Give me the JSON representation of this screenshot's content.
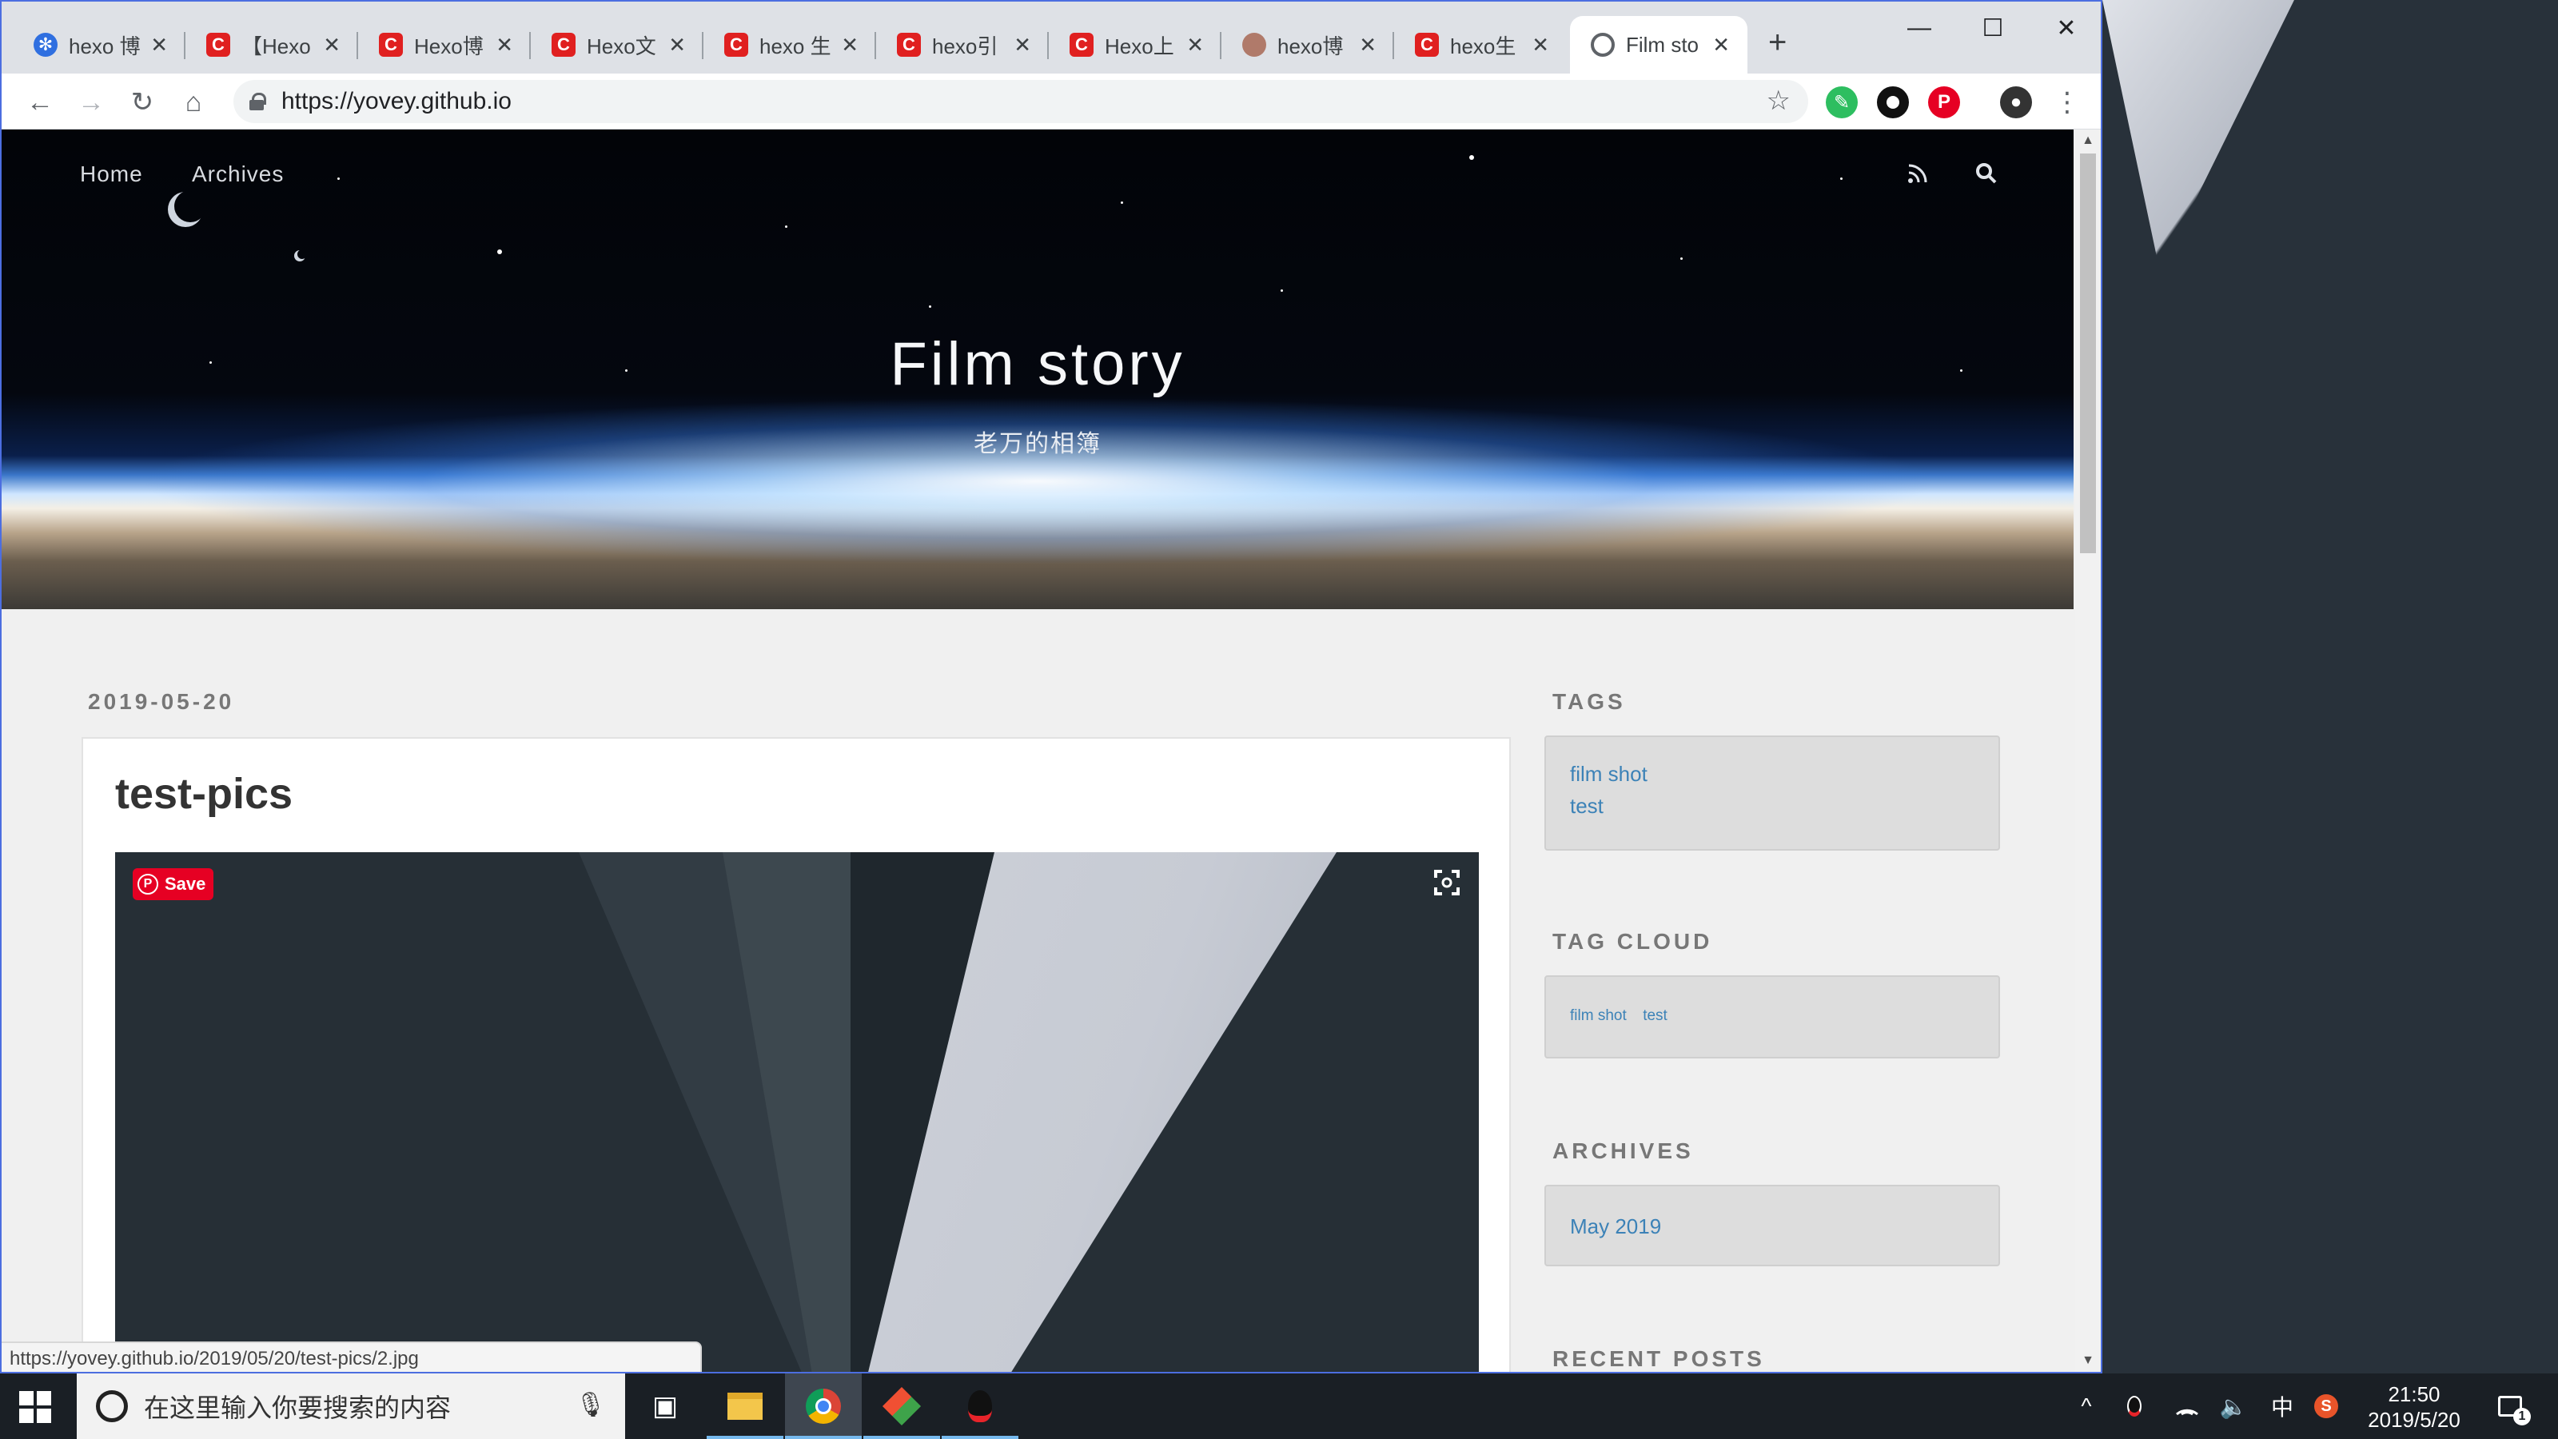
{
  "browser": {
    "tabs": [
      {
        "title": "hexo 博",
        "icon": "baidu-paw-icon"
      },
      {
        "title": "【Hexo",
        "icon": "csdn-icon"
      },
      {
        "title": "Hexo博",
        "icon": "csdn-icon"
      },
      {
        "title": "Hexo文",
        "icon": "csdn-icon"
      },
      {
        "title": "hexo 生",
        "icon": "csdn-icon"
      },
      {
        "title": "hexo引",
        "icon": "csdn-icon"
      },
      {
        "title": "Hexo上",
        "icon": "csdn-icon"
      },
      {
        "title": "hexo博",
        "icon": "anime-avatar-icon"
      },
      {
        "title": "hexo生",
        "icon": "csdn-icon"
      },
      {
        "title": "Film sto",
        "icon": "globe-icon",
        "active": true
      }
    ],
    "new_tab": "+",
    "url": "https://yovey.github.io",
    "status_url": "https://yovey.github.io/2019/05/20/test-pics/2.jpg"
  },
  "site": {
    "nav": {
      "home": "Home",
      "archives": "Archives"
    },
    "title": "Film story",
    "subtitle": "老万的相簿"
  },
  "post": {
    "date": "2019-05-20",
    "title": "test-pics",
    "save_label": "Save"
  },
  "sidebar": {
    "tags_heading": "TAGS",
    "tags": [
      "film shot",
      "test"
    ],
    "tag_cloud_heading": "TAG CLOUD",
    "tag_cloud": [
      "film shot",
      "test"
    ],
    "archives_heading": "ARCHIVES",
    "archives": [
      "May 2019"
    ],
    "recent_heading": "RECENT POSTS"
  },
  "taskbar": {
    "search_placeholder": "在这里输入你要搜索的内容",
    "ime": "中",
    "time": "21:50",
    "date": "2019/5/20",
    "notification_count": "1"
  },
  "colors": {
    "link": "#3c82b7",
    "pinterest": "#e60023",
    "csdn": "#e02020",
    "taskbar": "#1a1f25"
  }
}
